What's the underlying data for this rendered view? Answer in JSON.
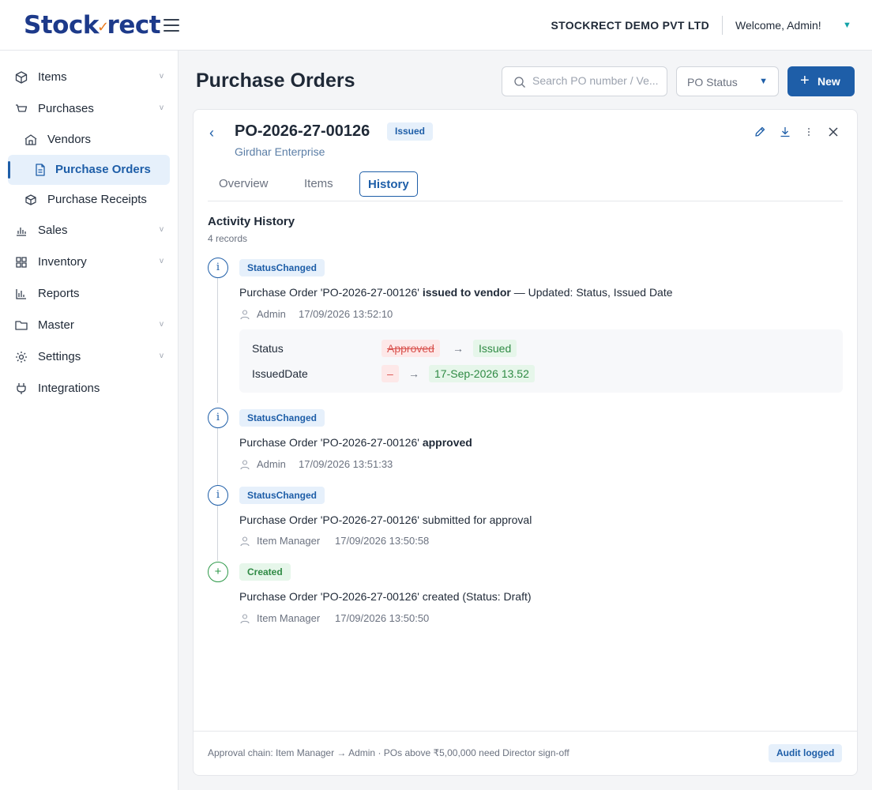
{
  "brand": {
    "logo_pre": "Stock",
    "logo_mark": "✓",
    "logo_post": "rect"
  },
  "header": {
    "company": "STOCKRECT DEMO PVT LTD",
    "welcome": "Welcome, Admin!"
  },
  "sidebar": {
    "items": [
      {
        "label": "Items",
        "icon": "cube-icon"
      },
      {
        "label": "Purchases",
        "icon": "cart-icon"
      },
      {
        "label": "Vendors",
        "icon": "store-icon"
      },
      {
        "label": "Purchase Orders",
        "icon": "document-icon"
      },
      {
        "label": "Purchase Receipts",
        "icon": "box-icon"
      },
      {
        "label": "Sales",
        "icon": "bar-chart-icon"
      },
      {
        "label": "Inventory",
        "icon": "grid-icon"
      },
      {
        "label": "Reports",
        "icon": "column-chart-icon"
      },
      {
        "label": "Master",
        "icon": "folder-icon"
      },
      {
        "label": "Settings",
        "icon": "gear-icon"
      },
      {
        "label": "Integrations",
        "icon": "plug-icon"
      }
    ]
  },
  "main": {
    "title": "Purchase Orders",
    "search_placeholder": "Search PO number / Ve...",
    "status_filter": "PO Status",
    "new_button": "New"
  },
  "po": {
    "number": "PO-2026-27-00126",
    "status": "Issued",
    "vendor": "Girdhar Enterprise",
    "tabs": [
      "Overview",
      "Items",
      "History"
    ],
    "active_tab": "History"
  },
  "history": {
    "title": "Activity History",
    "count": "4 records",
    "entries": [
      {
        "tag": "StatusChanged",
        "msg_pre": "Purchase Order 'PO-2026-27-00126' ",
        "msg_bold": "issued to vendor",
        "msg_post": " — Updated: Status, Issued Date",
        "user": "Admin",
        "time": "17/09/2026 13:52:10",
        "changes": [
          {
            "field": "Status",
            "old": "Approved",
            "new": "Issued"
          },
          {
            "field": "IssuedDate",
            "old": "–",
            "new": "17-Sep-2026 13.52"
          }
        ]
      },
      {
        "tag": "StatusChanged",
        "msg_pre": "Purchase Order 'PO-2026-27-00126' ",
        "msg_bold": "approved",
        "msg_post": "",
        "user": "Admin",
        "time": "17/09/2026 13:51:33"
      },
      {
        "tag": "StatusChanged",
        "msg_pre": "Purchase Order 'PO-2026-27-00126' submitted for approval",
        "msg_bold": "",
        "msg_post": "",
        "user": "Item Manager",
        "time": "17/09/2026 13:50:58"
      },
      {
        "tag": "Created",
        "msg_pre": "Purchase Order 'PO-2026-27-00126' created (Status: Draft)",
        "msg_bold": "",
        "msg_post": "",
        "user": "Item Manager",
        "time": "17/09/2026 13:50:50"
      }
    ],
    "arrow": "→"
  },
  "footer": {
    "note": "Approval chain: Item Manager → Admin · POs above ₹5,00,000 need Director sign-off",
    "audit_badge": "Audit logged"
  },
  "colors": {
    "primary": "#1e5ea8",
    "brand_blue": "#1d3a8a",
    "brand_orange": "#e97a1f",
    "success": "#2f8a44",
    "danger": "#d9534f"
  }
}
